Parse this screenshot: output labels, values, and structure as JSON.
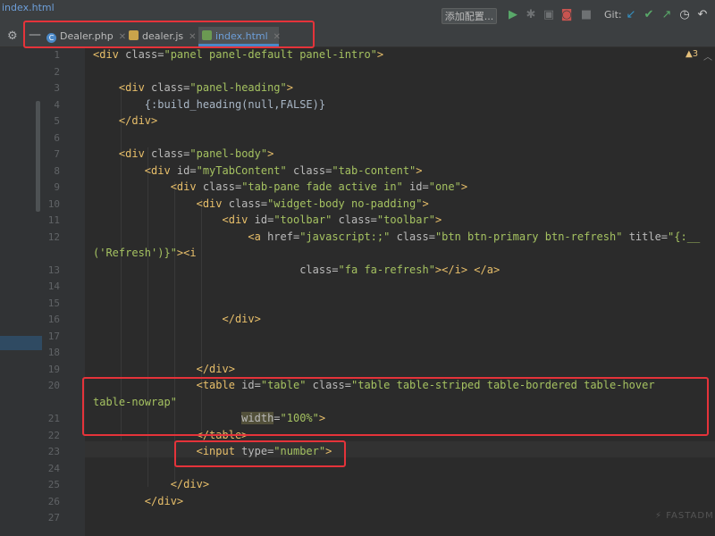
{
  "window": {
    "file_title": "index.html"
  },
  "toolbar": {
    "add_config_label": "添加配置...",
    "git_label": "Git:",
    "icons": [
      "run-icon",
      "debug-icon",
      "coverage-icon",
      "profile-icon",
      "stop-icon",
      "git-update-icon",
      "git-commit-icon",
      "git-push-icon",
      "history-icon",
      "revert-icon"
    ]
  },
  "tabs": [
    {
      "label": "Dealer.php",
      "icon": "php-file-icon",
      "icon_color": "#4a88c7",
      "active": false
    },
    {
      "label": "dealer.js",
      "icon": "js-file-icon",
      "icon_color": "#c9a44b",
      "active": false
    },
    {
      "label": "index.html",
      "icon": "html-file-icon",
      "icon_color": "#6b9a52",
      "active": true
    }
  ],
  "editor": {
    "warning_count": "3",
    "watermark": "FASTADM",
    "lines": [
      {
        "n": "1",
        "segs": [
          [
            "t",
            "<div "
          ],
          [
            "a",
            "class="
          ],
          [
            "v",
            "\"panel panel-default panel-intro\""
          ],
          [
            "t",
            ">"
          ]
        ]
      },
      {
        "n": "2",
        "segs": []
      },
      {
        "n": "3",
        "segs": [
          [
            "t",
            "    <div "
          ],
          [
            "a",
            "class="
          ],
          [
            "v",
            "\"panel-heading\""
          ],
          [
            "t",
            ">"
          ]
        ]
      },
      {
        "n": "4",
        "segs": [
          [
            "x",
            "        {:build_heading(null,FALSE)}"
          ]
        ]
      },
      {
        "n": "5",
        "segs": [
          [
            "t",
            "    </div>"
          ]
        ]
      },
      {
        "n": "6",
        "segs": []
      },
      {
        "n": "7",
        "segs": [
          [
            "t",
            "    <div "
          ],
          [
            "a",
            "class="
          ],
          [
            "v",
            "\"panel-body\""
          ],
          [
            "t",
            ">"
          ]
        ]
      },
      {
        "n": "8",
        "segs": [
          [
            "t",
            "        <div "
          ],
          [
            "a",
            "id="
          ],
          [
            "v",
            "\"myTabContent\" "
          ],
          [
            "a",
            "class="
          ],
          [
            "v",
            "\"tab-content\""
          ],
          [
            "t",
            ">"
          ]
        ]
      },
      {
        "n": "9",
        "segs": [
          [
            "t",
            "            <div "
          ],
          [
            "a",
            "class="
          ],
          [
            "v",
            "\"tab-pane fade active in\" "
          ],
          [
            "a",
            "id="
          ],
          [
            "v",
            "\"one\""
          ],
          [
            "t",
            ">"
          ]
        ]
      },
      {
        "n": "10",
        "segs": [
          [
            "t",
            "                <div "
          ],
          [
            "a",
            "class="
          ],
          [
            "v",
            "\"widget-body no-padding\""
          ],
          [
            "t",
            ">"
          ]
        ]
      },
      {
        "n": "11",
        "segs": [
          [
            "t",
            "                    <div "
          ],
          [
            "a",
            "id="
          ],
          [
            "v",
            "\"toolbar\" "
          ],
          [
            "a",
            "class="
          ],
          [
            "v",
            "\"toolbar\""
          ],
          [
            "t",
            ">"
          ]
        ]
      },
      {
        "n": "12",
        "segs": [
          [
            "t",
            "                        <a "
          ],
          [
            "a",
            "href="
          ],
          [
            "v",
            "\"javascript:;\" "
          ],
          [
            "a",
            "class="
          ],
          [
            "v",
            "\"btn btn-primary btn-refresh\" "
          ],
          [
            "a",
            "title="
          ],
          [
            "v",
            "\"{:__"
          ]
        ]
      },
      {
        "n": "",
        "segs": [
          [
            "v",
            "('Refresh')}\""
          ],
          [
            "t",
            ">"
          ],
          [
            "t",
            "<i"
          ]
        ]
      },
      {
        "n": "13",
        "segs": [
          [
            "t",
            "                                "
          ],
          [
            "a",
            "class="
          ],
          [
            "v",
            "\"fa fa-refresh\""
          ],
          [
            "t",
            "></i> </a>"
          ]
        ]
      },
      {
        "n": "14",
        "segs": []
      },
      {
        "n": "15",
        "segs": []
      },
      {
        "n": "16",
        "segs": [
          [
            "t",
            "                    </div>"
          ]
        ]
      },
      {
        "n": "17",
        "segs": []
      },
      {
        "n": "18",
        "segs": []
      },
      {
        "n": "19",
        "segs": [
          [
            "t",
            "                </div>"
          ]
        ]
      },
      {
        "n": "20",
        "segs": [
          [
            "t",
            "                <table "
          ],
          [
            "a",
            "id="
          ],
          [
            "v",
            "\"table\" "
          ],
          [
            "a",
            "class="
          ],
          [
            "v",
            "\"table table-striped table-bordered table-hover"
          ]
        ]
      },
      {
        "n": "",
        "segs": [
          [
            "v",
            "table-nowrap\""
          ]
        ]
      },
      {
        "n": "21",
        "segs": [
          [
            "t",
            "                       "
          ],
          [
            "w",
            "width"
          ],
          [
            "a",
            "="
          ],
          [
            "v",
            "\"100%\""
          ],
          [
            "t",
            ">"
          ]
        ]
      },
      {
        "n": "22",
        "segs": [
          [
            "t",
            "                </table>"
          ]
        ]
      },
      {
        "n": "23",
        "segs": [
          [
            "t",
            "                <input "
          ],
          [
            "a",
            "type="
          ],
          [
            "v",
            "\"number\""
          ],
          [
            "t",
            ">"
          ]
        ]
      },
      {
        "n": "24",
        "segs": []
      },
      {
        "n": "25",
        "segs": [
          [
            "t",
            "            </div>"
          ]
        ]
      },
      {
        "n": "26",
        "segs": [
          [
            "t",
            "        </div>"
          ]
        ]
      },
      {
        "n": "27",
        "segs": []
      }
    ]
  }
}
